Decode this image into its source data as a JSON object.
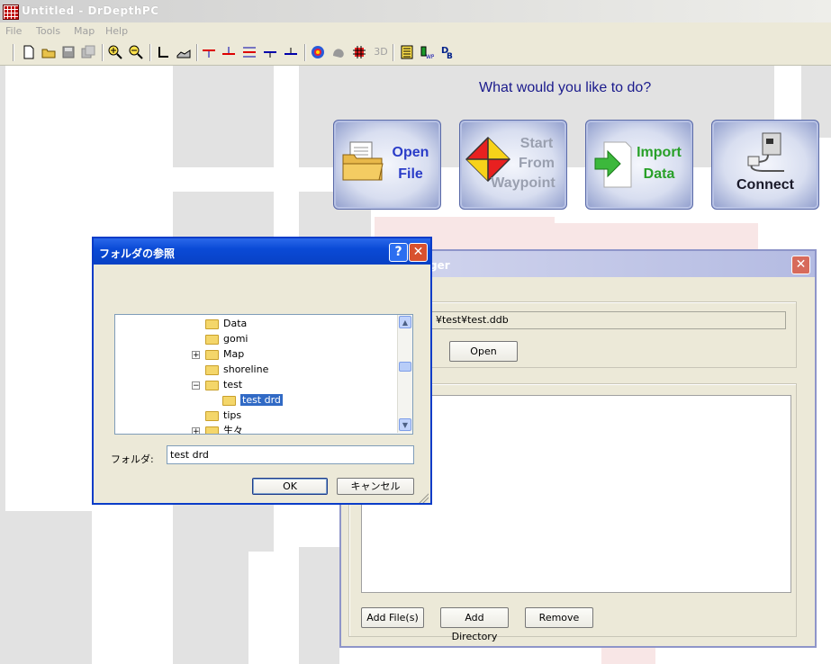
{
  "window": {
    "title": "Untitled - DrDepthPC",
    "icon": "grid-app-icon"
  },
  "menu": [
    "File",
    "Tools",
    "Map",
    "Help"
  ],
  "toolbar": {
    "buttons": [
      "new-icon",
      "open-icon",
      "save-icon",
      "save-all-icon",
      "zoom-in-icon",
      "zoom-out-icon",
      "axis-icon",
      "profile-icon",
      "depth-tool-1-icon",
      "depth-tool-2-icon",
      "depth-tool-3-icon",
      "depth-tool-4-icon",
      "depth-tool-5-icon",
      "color-map-icon",
      "shade-icon",
      "grid-icon",
      "3d-label",
      "list-icon",
      "waypoint-icon",
      "database-icon"
    ],
    "label_3d": "3D"
  },
  "welcome": {
    "prompt": "What would you like to do?",
    "buttons": [
      {
        "label1": "Open",
        "label2": "File",
        "color": "#2a3cc8"
      },
      {
        "label1": "Start",
        "label2": "From",
        "label3": "Waypoint",
        "color": "#9aa0b0"
      },
      {
        "label1": "Import",
        "label2": "Data",
        "color": "#28a028"
      },
      {
        "label1": "Connect",
        "color": "#1a1a2a"
      }
    ]
  },
  "file_manager": {
    "title_fragment": "ger",
    "path": "¥test¥test.ddb",
    "open_label": "Open",
    "add_files_label": "Add File(s)",
    "add_directory_label": "Add Directory",
    "remove_label": "Remove"
  },
  "browse_dialog": {
    "title": "フォルダの参照",
    "help": "?",
    "close": "✕",
    "tree": [
      {
        "label": "Data",
        "expander": ""
      },
      {
        "label": "gomi",
        "expander": ""
      },
      {
        "label": "Map",
        "expander": "+"
      },
      {
        "label": "shoreline",
        "expander": ""
      },
      {
        "label": "test",
        "expander": "−"
      },
      {
        "label": "test drd",
        "expander": "",
        "selected": true,
        "child": true
      },
      {
        "label": "tips",
        "expander": ""
      },
      {
        "label": "生々",
        "expander": "+"
      }
    ],
    "folder_label": "フォルダ:",
    "folder_value": "test drd",
    "ok_label": "OK",
    "cancel_label": "キャンセル"
  },
  "colors": {
    "title_active": "#0a4ad6",
    "title_inactive": "#b4bbe2",
    "button_text": "#1a1a8c",
    "selection": "#316ac5"
  }
}
